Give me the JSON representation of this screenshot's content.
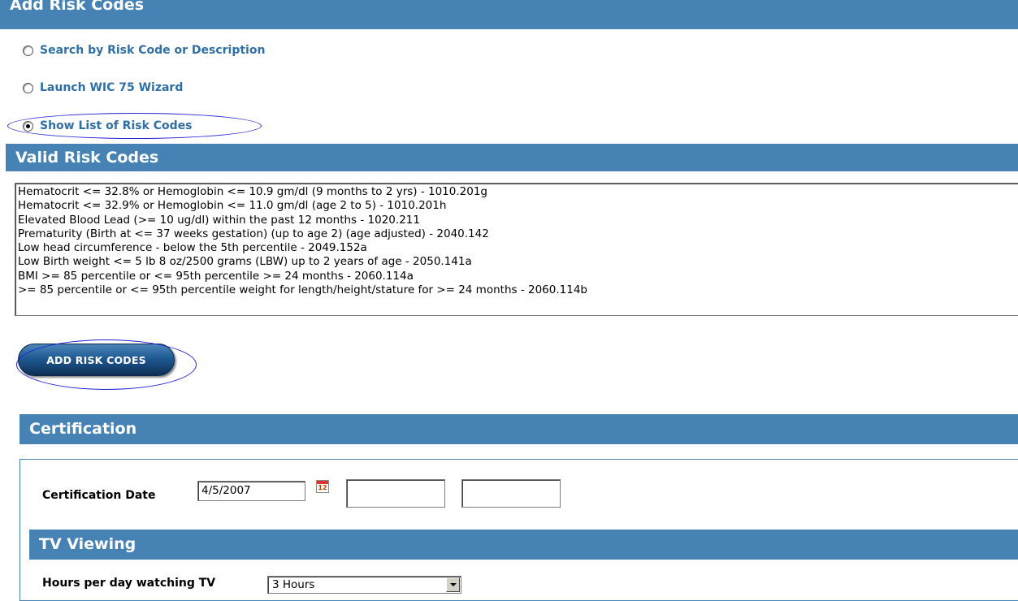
{
  "sections": {
    "add_risk_codes": "Add Risk Codes",
    "valid_risk_codes": "Valid Risk Codes",
    "certification": "Certification",
    "tv_viewing": "TV Viewing"
  },
  "radio_options": [
    {
      "label": "Search by Risk Code or Description",
      "checked": false
    },
    {
      "label": "Launch WIC 75 Wizard",
      "checked": false
    },
    {
      "label": "Show List of Risk Codes",
      "checked": true
    }
  ],
  "risk_codes": [
    "Hematocrit <= 32.8% or Hemoglobin <= 10.9 gm/dl (9 months to 2 yrs) - 1010.201g",
    "Hematocrit <= 32.9% or Hemoglobin <= 11.0 gm/dl (age 2 to 5) - 1010.201h",
    "Elevated Blood Lead (>= 10 ug/dl) within the past 12 months - 1020.211",
    "Prematurity (Birth at <= 37 weeks gestation) (up to age 2) (age adjusted) - 2040.142",
    "Low head circumference - below the 5th percentile - 2049.152a",
    "Low Birth weight <= 5 lb 8 oz/2500 grams (LBW) up to 2 years of age - 2050.141a",
    "BMI >= 85 percentile or <= 95th percentile >= 24 months - 2060.114a",
    ">= 85 percentile or <= 95th percentile weight for length/height/stature for >= 24 months - 2060.114b"
  ],
  "buttons": {
    "add_risk_codes": "ADD RISK CODES"
  },
  "certification": {
    "date_label": "Certification Date",
    "date_value": "4/5/2007",
    "calendar_day": "12",
    "extra_field_1": "",
    "extra_field_2": ""
  },
  "tv": {
    "hours_label": "Hours per day watching TV",
    "hours_value": "3 Hours"
  },
  "colors": {
    "section_bar": "#4682b4",
    "radio_label": "#2f6fa6",
    "highlight_ellipse": "#1f1fd6"
  }
}
